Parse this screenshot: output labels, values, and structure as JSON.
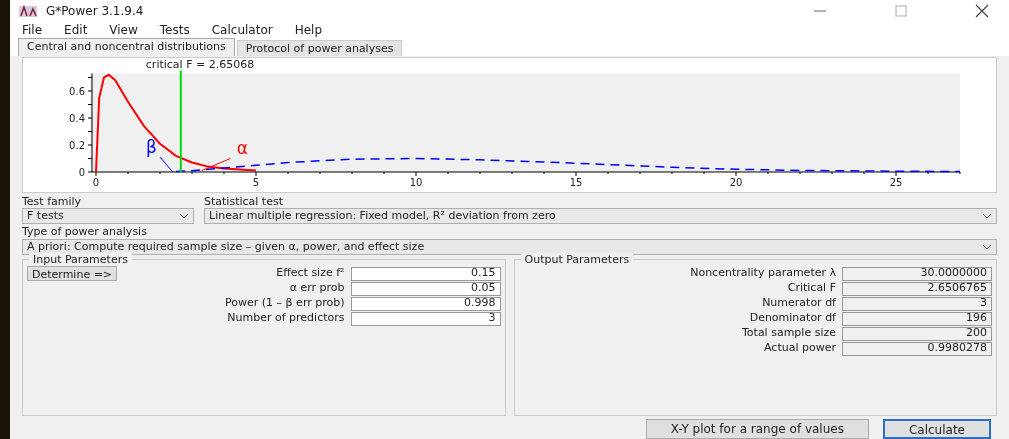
{
  "window": {
    "title": "G*Power 3.1.9.4"
  },
  "menu": [
    "File",
    "Edit",
    "View",
    "Tests",
    "Calculator",
    "Help"
  ],
  "tabs": [
    {
      "label": "Central and noncentral distributions",
      "selected": true
    },
    {
      "label": "Protocol of power analyses",
      "selected": false
    }
  ],
  "chart_data": {
    "type": "line",
    "x": [
      0,
      0.1,
      0.25,
      0.4,
      0.6,
      1,
      1.5,
      2,
      2.5,
      3,
      3.5,
      4,
      5,
      6,
      8,
      10,
      12,
      15,
      18,
      20,
      22,
      25,
      27
    ],
    "series": [
      {
        "color": "#ff0000",
        "values": [
          0,
          0.55,
          0.7,
          0.72,
          0.68,
          0.52,
          0.34,
          0.21,
          0.12,
          0.07,
          0.04,
          0.025,
          0.012,
          null,
          null,
          null,
          null,
          null,
          null,
          null,
          null,
          null,
          null
        ]
      },
      {
        "color": "#0000ff",
        "line_style": "dashed",
        "values": [
          null,
          null,
          null,
          null,
          null,
          null,
          null,
          null,
          0.003,
          0.01,
          0.02,
          0.03,
          0.05,
          0.07,
          0.095,
          0.1,
          0.09,
          0.065,
          0.035,
          0.02,
          0.012,
          0.006,
          0.004
        ]
      }
    ],
    "xlim": [
      0,
      27
    ],
    "ylim": [
      0,
      0.73
    ],
    "xticks": [
      0,
      5,
      10,
      15,
      20,
      25
    ],
    "yticks": [
      0,
      0.2,
      0.4,
      0.6
    ],
    "ref_lines": [
      {
        "axis": "x",
        "value": 2.65068,
        "color": "#00dd00",
        "label": "critical F =  2.65068"
      }
    ]
  },
  "chart_labels": [
    {
      "text": "β",
      "color": "#0000ff"
    },
    {
      "text": "α",
      "color": "#ff0000"
    }
  ],
  "selectors": [
    {
      "label": "Test family",
      "value": "F tests"
    },
    {
      "label": "Statistical test",
      "value": "Linear multiple regression: Fixed model, R² deviation from zero"
    },
    {
      "label": "Type of power analysis",
      "value": "A priori: Compute required sample size – given α, power, and effect size"
    }
  ],
  "input_parameters": {
    "title": "Input Parameters",
    "button": "Determine =>",
    "fields": [
      {
        "label": "Effect size f²",
        "value": "0.15"
      },
      {
        "label": "α err prob",
        "value": "0.05"
      },
      {
        "label": "Power (1 – β err prob)",
        "value": "0.998"
      },
      {
        "label": "Number of predictors",
        "value": "3"
      }
    ]
  },
  "output_parameters": {
    "title": "Output Parameters",
    "fields": [
      {
        "label": "Noncentrality parameter λ",
        "value": "30.0000000"
      },
      {
        "label": "Critical F",
        "value": "2.6506765"
      },
      {
        "label": "Numerator df",
        "value": "3"
      },
      {
        "label": "Denominator df",
        "value": "196"
      },
      {
        "label": "Total sample size",
        "value": "200"
      },
      {
        "label": "Actual power",
        "value": "0.9980278"
      }
    ]
  },
  "buttons": [
    {
      "label": "X-Y plot for a range of values",
      "kind": "plain"
    },
    {
      "label": "Calculate",
      "kind": "default"
    }
  ]
}
